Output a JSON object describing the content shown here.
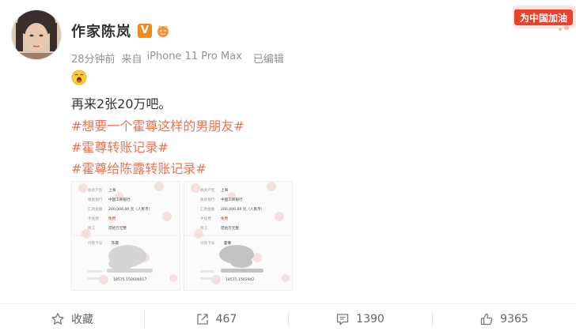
{
  "author": {
    "name": "作家陈岚",
    "verified_mark": "V",
    "badge_icon": "fan-badge-icon"
  },
  "meta": {
    "time": "28分钟前",
    "source_prefix": "来自",
    "device": "iPhone 11 Pro Max",
    "edited": "已编辑"
  },
  "campaign_badge": {
    "text": "为中国加油",
    "color": "#e8412c"
  },
  "post": {
    "emoji_icon": "yawning-face-icon",
    "text": "再来2张20万吧。",
    "hashtags": [
      "#想要一个霍尊这样的男朋友#",
      "#霍尊转账记录#",
      "#霍尊给陈露转账记录#"
    ],
    "images": [
      {
        "rows": [
          {
            "label": "收款户名",
            "value": "上海"
          },
          {
            "label": "收款银行",
            "value": "中国工商银行"
          },
          {
            "label": "汇款金额",
            "value": "200,000.00 元（人民币）"
          },
          {
            "label": "手续费",
            "value": "免费"
          },
          {
            "label": "附言",
            "value": "贰拾万元整"
          }
        ],
        "lower_label": "付款卡号",
        "lower_value": "陈霍",
        "serial": "18575 150600017"
      },
      {
        "rows": [
          {
            "label": "收款户名",
            "value": "上海"
          },
          {
            "label": "收款银行",
            "value": "中国工商银行"
          },
          {
            "label": "汇款金额",
            "value": "200,000.00 元（人民币）"
          },
          {
            "label": "手续费",
            "value": "免费"
          },
          {
            "label": "附言",
            "value": "贰拾万元整"
          }
        ],
        "lower_label": "付款卡号",
        "lower_value": "霍尊",
        "serial": "18575 1502942"
      }
    ]
  },
  "actions": {
    "favorite_label": "收藏",
    "repost_count": "467",
    "comment_count": "1390",
    "like_count": "9365"
  },
  "colors": {
    "hashtag": "#eb7350",
    "meta_text": "#939393",
    "verified": "#f08a1c"
  }
}
